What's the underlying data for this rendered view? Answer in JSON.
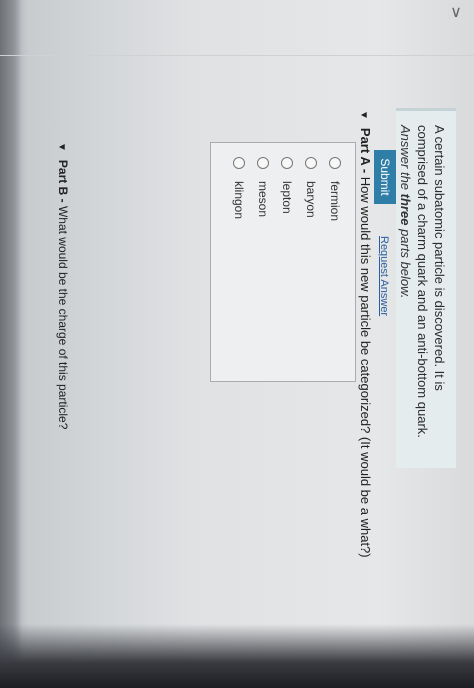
{
  "intro": {
    "text": "A certain subatomic particle is discovered. It is comprised of a charm quark and an anti-bottom quark.",
    "note_prefix": "Answer the ",
    "note_bold": "three",
    "note_suffix": " parts below."
  },
  "partA": {
    "label": "Part A -",
    "question": "How would this new particle be categorized? (It would be a what?)",
    "choices": [
      "fermion",
      "baryon",
      "lepton",
      "meson",
      "klingon"
    ],
    "submit_label": "Submit",
    "request_answer_label": "Request Answer"
  },
  "partB": {
    "label": "Part B -",
    "question": "What would be the charge of this particle?"
  },
  "colors": {
    "submit_bg": "#2f7ea8",
    "intro_bg": "#e4ecee"
  },
  "icons": {
    "collapse": "chevron-down-icon",
    "expand_toggle": "triangle-down-icon"
  }
}
